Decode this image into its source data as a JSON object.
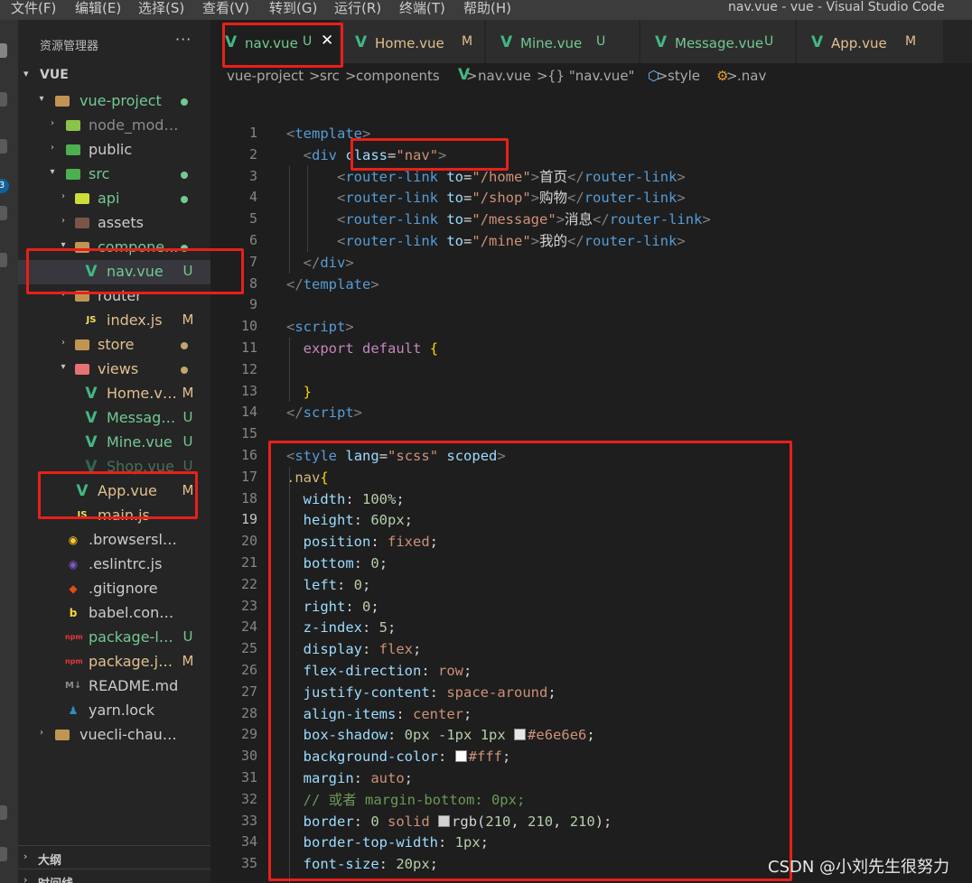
{
  "menu": [
    "文件(F)",
    "编辑(E)",
    "选择(S)",
    "查看(V)",
    "转到(G)",
    "运行(R)",
    "终端(T)",
    "帮助(H)"
  ],
  "window_title": "nav.vue - vue - Visual Studio Code",
  "activity": {
    "badge": "3"
  },
  "sidebar": {
    "header": "资源管理器",
    "more": "···",
    "root_label": "VUE",
    "tree": [
      {
        "label": "vue-project",
        "status": "",
        "dot": "#73c991",
        "color": "#73c991",
        "icon": "folder-open-icon"
      },
      {
        "label": "node_modules",
        "status": "",
        "dot": "",
        "color": "#8c8c8c",
        "icon": "folder-node-icon"
      },
      {
        "label": "public",
        "status": "",
        "dot": "",
        "color": "#cccccc",
        "icon": "folder-public-icon"
      },
      {
        "label": "src",
        "status": "",
        "dot": "#73c991",
        "color": "#73c991",
        "icon": "folder-src-icon"
      },
      {
        "label": "api",
        "status": "",
        "dot": "#73c991",
        "color": "#73c991",
        "icon": "folder-api-icon"
      },
      {
        "label": "assets",
        "status": "",
        "dot": "",
        "color": "#cccccc",
        "icon": "folder-assets-icon"
      },
      {
        "label": "compone...",
        "status": "",
        "dot": "#73c991",
        "color": "#73c991",
        "icon": "folder-components-icon"
      },
      {
        "label": "nav.vue",
        "status": "U",
        "dot": "",
        "color": "#73c991",
        "icon": "vue-file-icon"
      },
      {
        "label": "router",
        "status": "",
        "dot": "",
        "color": "#cccccc",
        "icon": "folder-router-icon"
      },
      {
        "label": "index.js",
        "status": "M",
        "dot": "",
        "color": "#e2c08d",
        "icon": "js-file-icon"
      },
      {
        "label": "store",
        "status": "",
        "dot": "#c2a46e",
        "color": "#e2c08d",
        "icon": "folder-store-icon"
      },
      {
        "label": "views",
        "status": "",
        "dot": "#c2a46e",
        "color": "#e2c08d",
        "icon": "folder-views-icon"
      },
      {
        "label": "Home.vue",
        "status": "M",
        "dot": "",
        "color": "#e2c08d",
        "icon": "vue-file-icon"
      },
      {
        "label": "Message...",
        "status": "U",
        "dot": "",
        "color": "#73c991",
        "icon": "vue-file-icon"
      },
      {
        "label": "Mine.vue",
        "status": "U",
        "dot": "",
        "color": "#73c991",
        "icon": "vue-file-icon"
      },
      {
        "label": "Shop.vue",
        "status": "U",
        "dot": "",
        "color": "#73c991",
        "icon": "vue-file-icon"
      },
      {
        "label": "App.vue",
        "status": "M",
        "dot": "",
        "color": "#e2c08d",
        "icon": "vue-file-icon"
      },
      {
        "label": "main.js",
        "status": "",
        "dot": "",
        "color": "#e2c08d",
        "icon": "js-file-icon"
      },
      {
        "label": ".browserslistrc",
        "status": "",
        "dot": "",
        "color": "#cccccc",
        "icon": "browserslist-icon"
      },
      {
        "label": ".eslintrc.js",
        "status": "",
        "dot": "",
        "color": "#cccccc",
        "icon": "eslint-icon"
      },
      {
        "label": ".gitignore",
        "status": "",
        "dot": "",
        "color": "#cccccc",
        "icon": "git-icon"
      },
      {
        "label": "babel.config.js",
        "status": "",
        "dot": "",
        "color": "#cccccc",
        "icon": "babel-icon"
      },
      {
        "label": "package-lo...",
        "status": "U",
        "dot": "",
        "color": "#73c991",
        "icon": "npm-icon"
      },
      {
        "label": "package.js...",
        "status": "M",
        "dot": "",
        "color": "#e2c08d",
        "icon": "npm-icon"
      },
      {
        "label": "README.md",
        "status": "",
        "dot": "",
        "color": "#cccccc",
        "icon": "markdown-icon"
      },
      {
        "label": "yarn.lock",
        "status": "",
        "dot": "",
        "color": "#cccccc",
        "icon": "yarn-icon"
      },
      {
        "label": "vuecli-chauncan",
        "status": "",
        "dot": "",
        "color": "#cccccc",
        "icon": "folder-icon"
      }
    ],
    "outline": "大纲",
    "timeline": "时间线"
  },
  "tabs": [
    {
      "label": "nav.vue",
      "status": "U",
      "status_color": "#73c991",
      "active": true
    },
    {
      "label": "Home.vue",
      "status": "M",
      "status_color": "#e2c08d",
      "active": false
    },
    {
      "label": "Mine.vue",
      "status": "U",
      "status_color": "#73c991",
      "active": false
    },
    {
      "label": "Message.vue",
      "status": "U",
      "status_color": "#73c991",
      "active": false
    },
    {
      "label": "App.vue",
      "status": "M",
      "status_color": "#e2c08d",
      "active": false
    }
  ],
  "breadcrumb": [
    "vue-project",
    "src",
    "components",
    "nav.vue",
    "{} \"nav.vue\"",
    "style",
    ".nav"
  ],
  "breadcrumb_sep": ">",
  "editor": {
    "current_line": 19,
    "lines": [
      [
        [
          "c-tag",
          "<"
        ],
        [
          "c-name",
          "template"
        ],
        [
          "c-tag",
          ">"
        ]
      ],
      [
        [
          "c-txt",
          "  "
        ],
        [
          "c-tag",
          "<"
        ],
        [
          "c-name",
          "div"
        ],
        [
          "c-txt",
          " "
        ],
        [
          "c-attr",
          "class"
        ],
        [
          "c-txt",
          "="
        ],
        [
          "c-str",
          "\"nav\""
        ],
        [
          "c-tag",
          ">"
        ]
      ],
      [
        [
          "c-txt",
          "      "
        ],
        [
          "c-tag",
          "<"
        ],
        [
          "c-name",
          "router-link"
        ],
        [
          "c-txt",
          " "
        ],
        [
          "c-attr",
          "to"
        ],
        [
          "c-txt",
          "="
        ],
        [
          "c-str",
          "\"/home\""
        ],
        [
          "c-tag",
          ">"
        ],
        [
          "c-txt",
          "首页"
        ],
        [
          "c-tag",
          "</"
        ],
        [
          "c-name",
          "router-link"
        ],
        [
          "c-tag",
          ">"
        ]
      ],
      [
        [
          "c-txt",
          "      "
        ],
        [
          "c-tag",
          "<"
        ],
        [
          "c-name",
          "router-link"
        ],
        [
          "c-txt",
          " "
        ],
        [
          "c-attr",
          "to"
        ],
        [
          "c-txt",
          "="
        ],
        [
          "c-str",
          "\"/shop\""
        ],
        [
          "c-tag",
          ">"
        ],
        [
          "c-txt",
          "购物"
        ],
        [
          "c-tag",
          "</"
        ],
        [
          "c-name",
          "router-link"
        ],
        [
          "c-tag",
          ">"
        ]
      ],
      [
        [
          "c-txt",
          "      "
        ],
        [
          "c-tag",
          "<"
        ],
        [
          "c-name",
          "router-link"
        ],
        [
          "c-txt",
          " "
        ],
        [
          "c-attr",
          "to"
        ],
        [
          "c-txt",
          "="
        ],
        [
          "c-str",
          "\"/message\""
        ],
        [
          "c-tag",
          ">"
        ],
        [
          "c-txt",
          "消息"
        ],
        [
          "c-tag",
          "</"
        ],
        [
          "c-name",
          "router-link"
        ],
        [
          "c-tag",
          ">"
        ]
      ],
      [
        [
          "c-txt",
          "      "
        ],
        [
          "c-tag",
          "<"
        ],
        [
          "c-name",
          "router-link"
        ],
        [
          "c-txt",
          " "
        ],
        [
          "c-attr",
          "to"
        ],
        [
          "c-txt",
          "="
        ],
        [
          "c-str",
          "\"/mine\""
        ],
        [
          "c-tag",
          ">"
        ],
        [
          "c-txt",
          "我的"
        ],
        [
          "c-tag",
          "</"
        ],
        [
          "c-name",
          "router-link"
        ],
        [
          "c-tag",
          ">"
        ]
      ],
      [
        [
          "c-txt",
          "  "
        ],
        [
          "c-tag",
          "</"
        ],
        [
          "c-name",
          "div"
        ],
        [
          "c-tag",
          ">"
        ]
      ],
      [
        [
          "c-tag",
          "</"
        ],
        [
          "c-name",
          "template"
        ],
        [
          "c-tag",
          ">"
        ]
      ],
      [],
      [
        [
          "c-tag",
          "<"
        ],
        [
          "c-name",
          "script"
        ],
        [
          "c-tag",
          ">"
        ]
      ],
      [
        [
          "c-txt",
          "  "
        ],
        [
          "c-kw",
          "export"
        ],
        [
          "c-txt",
          " "
        ],
        [
          "c-kw",
          "default"
        ],
        [
          "c-txt",
          " "
        ],
        [
          "c-brace",
          "{"
        ]
      ],
      [],
      [
        [
          "c-txt",
          "  "
        ],
        [
          "c-brace",
          "}"
        ]
      ],
      [
        [
          "c-tag",
          "</"
        ],
        [
          "c-name",
          "script"
        ],
        [
          "c-tag",
          ">"
        ]
      ],
      [],
      [
        [
          "c-tag",
          "<"
        ],
        [
          "c-name",
          "style"
        ],
        [
          "c-txt",
          " "
        ],
        [
          "c-attr",
          "lang"
        ],
        [
          "c-txt",
          "="
        ],
        [
          "c-str",
          "\"scss\""
        ],
        [
          "c-txt",
          " "
        ],
        [
          "c-attr",
          "scoped"
        ],
        [
          "c-tag",
          ">"
        ]
      ],
      [
        [
          "c-sel",
          ".nav"
        ],
        [
          "c-brace",
          "{"
        ]
      ],
      [
        [
          "c-txt",
          "  "
        ],
        [
          "c-prop",
          "width"
        ],
        [
          "c-txt",
          ": "
        ],
        [
          "c-num",
          "100%"
        ],
        [
          "c-txt",
          ";"
        ]
      ],
      [
        [
          "c-txt",
          "  "
        ],
        [
          "c-prop",
          "height"
        ],
        [
          "c-txt",
          ": "
        ],
        [
          "c-num",
          "60px"
        ],
        [
          "c-txt",
          ";"
        ]
      ],
      [
        [
          "c-txt",
          "  "
        ],
        [
          "c-prop",
          "position"
        ],
        [
          "c-txt",
          ": "
        ],
        [
          "c-val",
          "fixed"
        ],
        [
          "c-txt",
          ";"
        ]
      ],
      [
        [
          "c-txt",
          "  "
        ],
        [
          "c-prop",
          "bottom"
        ],
        [
          "c-txt",
          ": "
        ],
        [
          "c-num",
          "0"
        ],
        [
          "c-txt",
          ";"
        ]
      ],
      [
        [
          "c-txt",
          "  "
        ],
        [
          "c-prop",
          "left"
        ],
        [
          "c-txt",
          ": "
        ],
        [
          "c-num",
          "0"
        ],
        [
          "c-txt",
          ";"
        ]
      ],
      [
        [
          "c-txt",
          "  "
        ],
        [
          "c-prop",
          "right"
        ],
        [
          "c-txt",
          ": "
        ],
        [
          "c-num",
          "0"
        ],
        [
          "c-txt",
          ";"
        ]
      ],
      [
        [
          "c-txt",
          "  "
        ],
        [
          "c-prop",
          "z-index"
        ],
        [
          "c-txt",
          ": "
        ],
        [
          "c-num",
          "5"
        ],
        [
          "c-txt",
          ";"
        ]
      ],
      [
        [
          "c-txt",
          "  "
        ],
        [
          "c-prop",
          "display"
        ],
        [
          "c-txt",
          ": "
        ],
        [
          "c-val",
          "flex"
        ],
        [
          "c-txt",
          ";"
        ]
      ],
      [
        [
          "c-txt",
          "  "
        ],
        [
          "c-prop",
          "flex-direction"
        ],
        [
          "c-txt",
          ": "
        ],
        [
          "c-val",
          "row"
        ],
        [
          "c-txt",
          ";"
        ]
      ],
      [
        [
          "c-txt",
          "  "
        ],
        [
          "c-prop",
          "justify-content"
        ],
        [
          "c-txt",
          ": "
        ],
        [
          "c-val",
          "space-around"
        ],
        [
          "c-txt",
          ";"
        ]
      ],
      [
        [
          "c-txt",
          "  "
        ],
        [
          "c-prop",
          "align-items"
        ],
        [
          "c-txt",
          ": "
        ],
        [
          "c-val",
          "center"
        ],
        [
          "c-txt",
          ";"
        ]
      ],
      [
        [
          "c-txt",
          "  "
        ],
        [
          "c-prop",
          "box-shadow"
        ],
        [
          "c-txt",
          ": "
        ],
        [
          "c-num",
          "0px"
        ],
        [
          "c-txt",
          " "
        ],
        [
          "c-num",
          "-1px"
        ],
        [
          "c-txt",
          " "
        ],
        [
          "c-num",
          "1px"
        ],
        [
          "c-txt",
          " "
        ],
        [
          "swatch:#e6e6e6",
          ""
        ],
        [
          "c-val",
          "#e6e6e6"
        ],
        [
          "c-txt",
          ";"
        ]
      ],
      [
        [
          "c-txt",
          "  "
        ],
        [
          "c-prop",
          "background-color"
        ],
        [
          "c-txt",
          ": "
        ],
        [
          "swatch:#ffffff",
          ""
        ],
        [
          "c-val",
          "#fff"
        ],
        [
          "c-txt",
          ";"
        ]
      ],
      [
        [
          "c-txt",
          "  "
        ],
        [
          "c-prop",
          "margin"
        ],
        [
          "c-txt",
          ": "
        ],
        [
          "c-val",
          "auto"
        ],
        [
          "c-txt",
          ";"
        ]
      ],
      [
        [
          "c-txt",
          "  "
        ],
        [
          "c-cmt",
          "// 或者 margin-bottom: 0px;"
        ]
      ],
      [
        [
          "c-txt",
          "  "
        ],
        [
          "c-prop",
          "border"
        ],
        [
          "c-txt",
          ": "
        ],
        [
          "c-num",
          "0"
        ],
        [
          "c-txt",
          " "
        ],
        [
          "c-val",
          "solid"
        ],
        [
          "c-txt",
          " "
        ],
        [
          "swatch:#d2d2d2",
          ""
        ],
        [
          "c-txt",
          "rgb("
        ],
        [
          "c-num",
          "210"
        ],
        [
          "c-txt",
          ", "
        ],
        [
          "c-num",
          "210"
        ],
        [
          "c-txt",
          ", "
        ],
        [
          "c-num",
          "210"
        ],
        [
          "c-txt",
          ");"
        ]
      ],
      [
        [
          "c-txt",
          "  "
        ],
        [
          "c-prop",
          "border-top-width"
        ],
        [
          "c-txt",
          ": "
        ],
        [
          "c-num",
          "1px"
        ],
        [
          "c-txt",
          ";"
        ]
      ],
      [
        [
          "c-txt",
          "  "
        ],
        [
          "c-prop",
          "font-size"
        ],
        [
          "c-txt",
          ": "
        ],
        [
          "c-num",
          "20px"
        ],
        [
          "c-txt",
          ";"
        ]
      ]
    ]
  },
  "watermark": "CSDN @小刘先生很努力"
}
